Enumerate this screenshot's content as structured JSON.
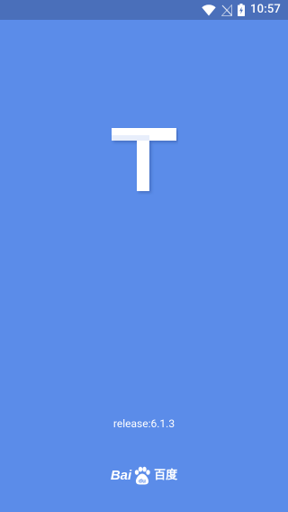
{
  "status_bar": {
    "time": "10:57",
    "icons": [
      "wifi-icon",
      "no-signal-icon",
      "battery-charging-icon"
    ]
  },
  "splash": {
    "logo_letter": "T",
    "release_label": "release:6.1.3"
  },
  "brand": {
    "latin_part1": "Ba",
    "latin_part2": "i",
    "paw_text": "du",
    "chinese": "百度"
  },
  "colors": {
    "background": "#5b8ce9",
    "status_bar": "#4a6fba",
    "foreground": "#ffffff"
  }
}
